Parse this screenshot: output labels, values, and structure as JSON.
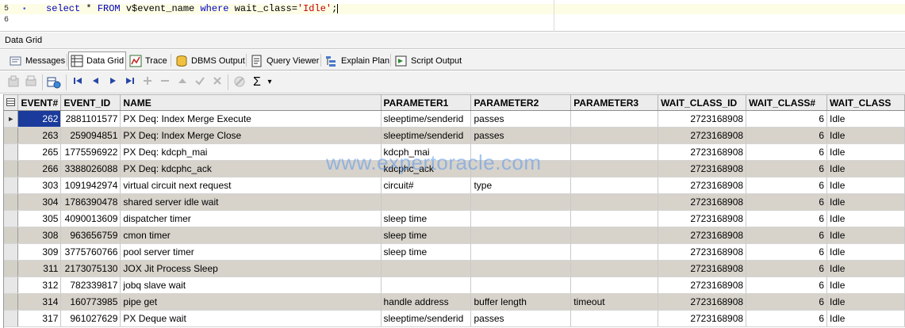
{
  "editor": {
    "lines": [
      {
        "num": "5",
        "marker": "•",
        "tokens": [
          {
            "t": "select",
            "c": "kw"
          },
          {
            "t": " * ",
            "c": ""
          },
          {
            "t": "FROM",
            "c": "kw"
          },
          {
            "t": " v$event_name ",
            "c": ""
          },
          {
            "t": "where",
            "c": "kw"
          },
          {
            "t": " wait_class=",
            "c": ""
          },
          {
            "t": "'Idle'",
            "c": "str"
          },
          {
            "t": ";",
            "c": ""
          }
        ]
      },
      {
        "num": "6",
        "marker": "",
        "tokens": []
      }
    ]
  },
  "section_title": "Data Grid",
  "tabs": [
    {
      "label": "Messages",
      "icon": "messages-icon",
      "active": false
    },
    {
      "label": "Data Grid",
      "icon": "grid-icon",
      "active": true
    },
    {
      "label": "Trace",
      "icon": "trace-icon",
      "active": false
    },
    {
      "label": "DBMS Output",
      "icon": "dbms-output-icon",
      "active": false
    },
    {
      "label": "Query Viewer",
      "icon": "query-viewer-icon",
      "active": false
    },
    {
      "label": "Explain Plan",
      "icon": "explain-plan-icon",
      "active": false
    },
    {
      "label": "Script Output",
      "icon": "script-output-icon",
      "active": false
    }
  ],
  "toolbar": {
    "sigma": "Σ",
    "dropdown": "▾"
  },
  "grid": {
    "columns": [
      "EVENT#",
      "EVENT_ID",
      "NAME",
      "PARAMETER1",
      "PARAMETER2",
      "PARAMETER3",
      "WAIT_CLASS_ID",
      "WAIT_CLASS#",
      "WAIT_CLASS"
    ],
    "rows": [
      [
        "262",
        "2881101577",
        "PX Deq: Index Merge Execute",
        "sleeptime/senderid",
        "passes",
        "",
        "2723168908",
        "6",
        "Idle"
      ],
      [
        "263",
        "259094851",
        "PX Deq: Index Merge Close",
        "sleeptime/senderid",
        "passes",
        "",
        "2723168908",
        "6",
        "Idle"
      ],
      [
        "265",
        "1775596922",
        "PX Deq: kdcph_mai",
        "kdcph_mai",
        "",
        "",
        "2723168908",
        "6",
        "Idle"
      ],
      [
        "266",
        "3388026088",
        "PX Deq: kdcphc_ack",
        "kdcphc_ack",
        "",
        "",
        "2723168908",
        "6",
        "Idle"
      ],
      [
        "303",
        "1091942974",
        "virtual circuit next request",
        "circuit#",
        "type",
        "",
        "2723168908",
        "6",
        "Idle"
      ],
      [
        "304",
        "1786390478",
        "shared server idle wait",
        "",
        "",
        "",
        "2723168908",
        "6",
        "Idle"
      ],
      [
        "305",
        "4090013609",
        "dispatcher timer",
        "sleep time",
        "",
        "",
        "2723168908",
        "6",
        "Idle"
      ],
      [
        "308",
        "963656759",
        "cmon timer",
        "sleep time",
        "",
        "",
        "2723168908",
        "6",
        "Idle"
      ],
      [
        "309",
        "3775760766",
        "pool server timer",
        "sleep time",
        "",
        "",
        "2723168908",
        "6",
        "Idle"
      ],
      [
        "311",
        "2173075130",
        "JOX Jit Process Sleep",
        "",
        "",
        "",
        "2723168908",
        "6",
        "Idle"
      ],
      [
        "312",
        "782339817",
        "jobq slave wait",
        "",
        "",
        "",
        "2723168908",
        "6",
        "Idle"
      ],
      [
        "314",
        "160773985",
        "pipe get",
        "handle address",
        "buffer length",
        "timeout",
        "2723168908",
        "6",
        "Idle"
      ],
      [
        "317",
        "961027629",
        "PX Deque wait",
        "sleeptime/senderid",
        "passes",
        "",
        "2723168908",
        "6",
        "Idle"
      ]
    ],
    "current_row_indicator": "►"
  },
  "watermark": "www.expertoracle.com"
}
